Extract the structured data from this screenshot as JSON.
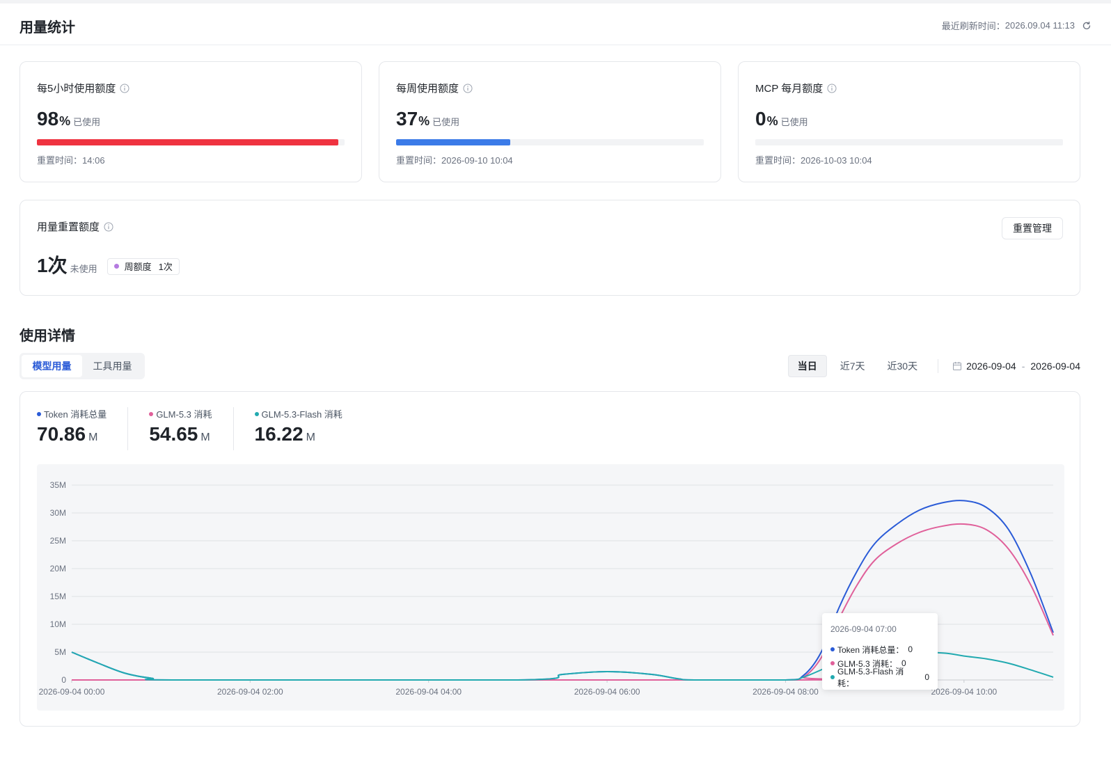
{
  "header": {
    "title": "用量统计",
    "refresh_label": "最近刷新时间：",
    "refresh_time": "2026.09.04 11:13"
  },
  "quotas": [
    {
      "title": "每5小时使用额度",
      "value": "98",
      "unit": "%",
      "sub": "已使用",
      "percent": 98,
      "color": "#ef3340",
      "reset_label": "重置时间：",
      "reset_time": "14:06"
    },
    {
      "title": "每周使用额度",
      "value": "37",
      "unit": "%",
      "sub": "已使用",
      "percent": 37,
      "color": "#3b7be8",
      "reset_label": "重置时间：",
      "reset_time": "2026-09-10 10:04"
    },
    {
      "title": "MCP 每月额度",
      "value": "0",
      "unit": "%",
      "sub": "已使用",
      "percent": 0,
      "color": "#3b7be8",
      "reset_label": "重置时间：",
      "reset_time": "2026-10-03 10:04"
    }
  ],
  "reset_quota": {
    "title": "用量重置额度",
    "value": "1次",
    "sub": "未使用",
    "pill_label": "周额度",
    "pill_count": "1次",
    "pill_color": "#b57be0",
    "manage_label": "重置管理"
  },
  "details": {
    "title": "使用详情",
    "tabs": [
      "模型用量",
      "工具用量"
    ],
    "active_tab": 0,
    "ranges": [
      "当日",
      "近7天",
      "近30天"
    ],
    "active_range": 0,
    "date_from": "2026-09-04",
    "date_to": "2026-09-04"
  },
  "stats": [
    {
      "label": "Token 消耗总量",
      "value": "70.86",
      "unit": "M",
      "color": "#2a5bd7"
    },
    {
      "label": "GLM-5.3 消耗",
      "value": "54.65",
      "unit": "M",
      "color": "#e0609a"
    },
    {
      "label": "GLM-5.3-Flash 消耗",
      "value": "16.22",
      "unit": "M",
      "color": "#22aab0"
    }
  ],
  "tooltip": {
    "title": "2026-09-04 07:00",
    "rows": [
      {
        "label": "Token 消耗总量：",
        "value": "0",
        "color": "#2a5bd7"
      },
      {
        "label": "GLM-5.3 消耗：",
        "value": "0",
        "color": "#e0609a"
      },
      {
        "label": "GLM-5.3-Flash 消耗：",
        "value": "0",
        "color": "#22aab0"
      }
    ]
  },
  "chart_data": {
    "type": "line",
    "y_ticks": [
      "0",
      "5M",
      "10M",
      "15M",
      "20M",
      "25M",
      "30M",
      "35M"
    ],
    "ylim": [
      0,
      35
    ],
    "x_labels": [
      {
        "label": "2026-09-04 00:00",
        "h": 0
      },
      {
        "label": "2026-09-04 02:00",
        "h": 2
      },
      {
        "label": "2026-09-04 04:00",
        "h": 4
      },
      {
        "label": "2026-09-04 06:00",
        "h": 6
      },
      {
        "label": "2026-09-04 08:00",
        "h": 8
      },
      {
        "label": "2026-09-04 10:00",
        "h": 10
      }
    ],
    "xlim": [
      0,
      11
    ],
    "grid": true,
    "series": [
      {
        "name": "Token 消耗总量",
        "color": "#2a5bd7",
        "points": [
          [
            0,
            5
          ],
          [
            0.3,
            3
          ],
          [
            0.6,
            1.2
          ],
          [
            0.9,
            0.3
          ],
          [
            1.2,
            0
          ],
          [
            5,
            0
          ],
          [
            5.5,
            1
          ],
          [
            6,
            1.5
          ],
          [
            6.5,
            1
          ],
          [
            6.8,
            0.2
          ],
          [
            7,
            0
          ],
          [
            8,
            0
          ],
          [
            8.2,
            0.8
          ],
          [
            8.4,
            5
          ],
          [
            8.6,
            13
          ],
          [
            8.8,
            19.5
          ],
          [
            9,
            24.5
          ],
          [
            9.25,
            28
          ],
          [
            9.5,
            30.5
          ],
          [
            9.75,
            31.8
          ],
          [
            10,
            32.2
          ],
          [
            10.25,
            31
          ],
          [
            10.5,
            27
          ],
          [
            10.75,
            19
          ],
          [
            11,
            8.5
          ]
        ]
      },
      {
        "name": "GLM-5.3 消耗",
        "color": "#e0609a",
        "points": [
          [
            0,
            0
          ],
          [
            8,
            0
          ],
          [
            8.2,
            0.5
          ],
          [
            8.4,
            4
          ],
          [
            8.6,
            11
          ],
          [
            8.8,
            17
          ],
          [
            9,
            21.5
          ],
          [
            9.25,
            24.5
          ],
          [
            9.5,
            26.5
          ],
          [
            9.75,
            27.6
          ],
          [
            10,
            28
          ],
          [
            10.25,
            27
          ],
          [
            10.5,
            23.5
          ],
          [
            10.75,
            17
          ],
          [
            11,
            8
          ]
        ]
      },
      {
        "name": "GLM-5.3-Flash 消耗",
        "color": "#22aab0",
        "points": [
          [
            0,
            5
          ],
          [
            0.3,
            3
          ],
          [
            0.6,
            1.2
          ],
          [
            0.9,
            0.3
          ],
          [
            1.2,
            0
          ],
          [
            5,
            0
          ],
          [
            5.5,
            1
          ],
          [
            6,
            1.5
          ],
          [
            6.5,
            1
          ],
          [
            6.8,
            0.2
          ],
          [
            7,
            0
          ],
          [
            8,
            0
          ],
          [
            8.2,
            0.5
          ],
          [
            8.5,
            2.5
          ],
          [
            8.8,
            4.3
          ],
          [
            9.1,
            5
          ],
          [
            9.5,
            5
          ],
          [
            9.8,
            4.8
          ],
          [
            10,
            4.3
          ],
          [
            10.25,
            3.8
          ],
          [
            10.5,
            3
          ],
          [
            10.75,
            1.8
          ],
          [
            11,
            0.5
          ]
        ]
      }
    ]
  }
}
